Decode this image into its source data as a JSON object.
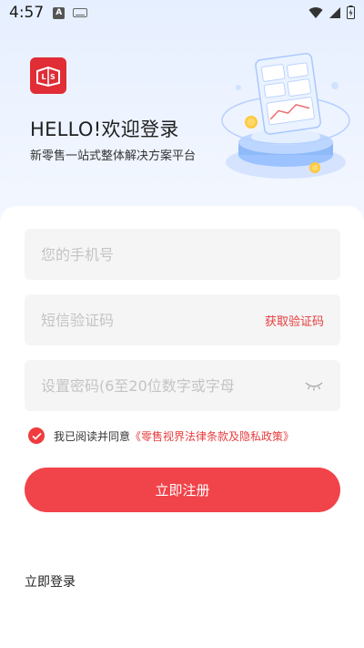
{
  "status_bar": {
    "time": "4:57",
    "notif_a": "A"
  },
  "header": {
    "greeting": "HELLO!欢迎登录",
    "subtitle": "新零售一站式整体解决方案平台"
  },
  "form": {
    "phone_placeholder": "您的手机号",
    "code_placeholder": "短信验证码",
    "get_code_label": "获取验证码",
    "password_placeholder": "设置密码(6至20位数字或字母"
  },
  "agreement": {
    "checked": true,
    "text": "我已阅读并同意",
    "link": "《零售视界法律条款及隐私政策》"
  },
  "register_button": "立即注册",
  "login_link": "立即登录",
  "colors": {
    "accent": "#f1434a",
    "brand_red": "#e02d36",
    "link_red": "#e73c3c",
    "hero_bg": "#e6efff"
  },
  "icons": [
    "text-a-icon",
    "keyboard-icon",
    "wifi-icon",
    "signal-icon",
    "battery-icon",
    "logo-icon",
    "check-icon",
    "eye-closed-icon"
  ]
}
